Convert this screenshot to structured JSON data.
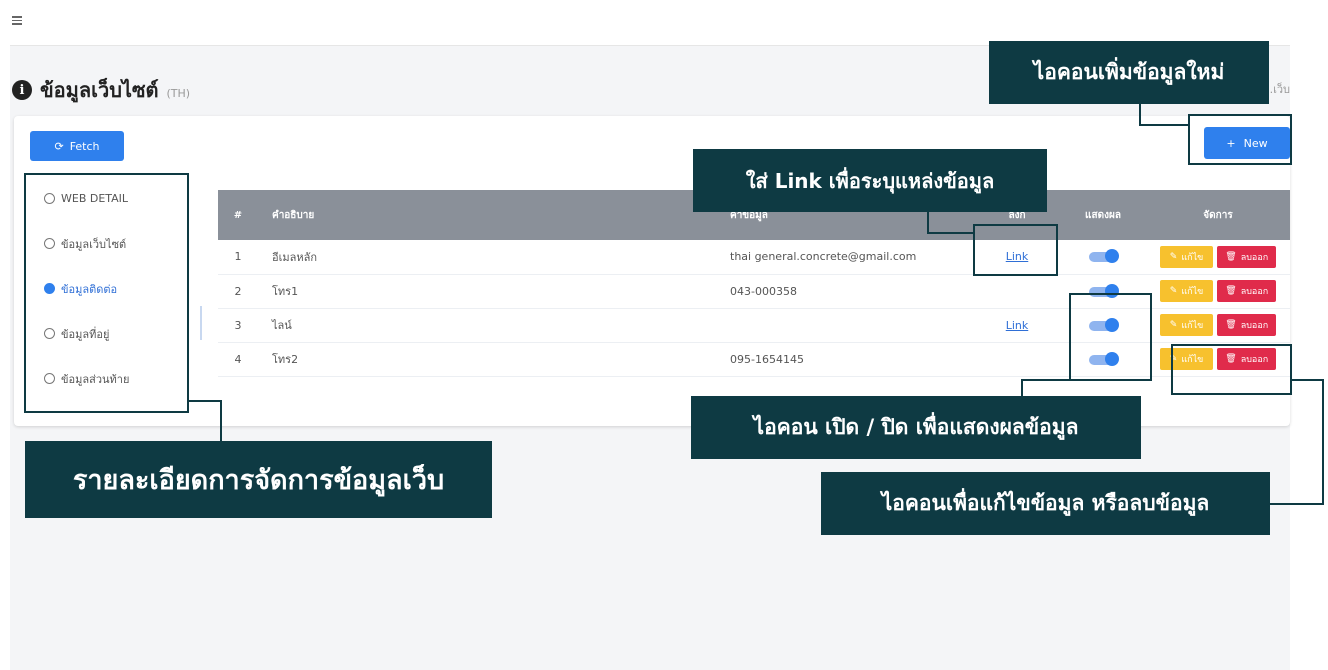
{
  "page": {
    "title": "ข้อมูลเว็บไซต์",
    "title_suffix": "(TH)",
    "breadcrumb": "ล.เว็บ",
    "info_icon": "i"
  },
  "toolbar": {
    "fetch_label": "Fetch",
    "fetch_icon": "⟳",
    "new_label": "New",
    "new_icon": "+"
  },
  "sidebar": {
    "items": [
      {
        "label": "WEB DETAIL",
        "active": false
      },
      {
        "label": "ข้อมูลเว็บไซต์",
        "active": false
      },
      {
        "label": "ข้อมูลติดต่อ",
        "active": true
      },
      {
        "label": "ข้อมูลที่อยู่",
        "active": false
      },
      {
        "label": "ข้อมูลส่วนท้าย",
        "active": false
      }
    ]
  },
  "table": {
    "headers": [
      "#",
      "คำอธิบาย",
      "ค่าข้อมูล",
      "ลิงก์",
      "แสดงผล",
      "จัดการ"
    ],
    "rows": [
      {
        "num": "1",
        "desc": "อีเมลหลัก",
        "value": "thai general.concrete@gmail.com",
        "link": "Link",
        "show": true
      },
      {
        "num": "2",
        "desc": "โทร1",
        "value": "043-000358",
        "link": "",
        "show": true
      },
      {
        "num": "3",
        "desc": "ไลน์",
        "value": "",
        "link": "Link",
        "show": true
      },
      {
        "num": "4",
        "desc": "โทร2",
        "value": "095-1654145",
        "link": "",
        "show": true
      }
    ],
    "edit_label": "แก้ไข",
    "delete_label": "ลบออก",
    "edit_icon": "✎",
    "delete_icon": "🗑"
  },
  "annotations": {
    "add_new": "ไอคอนเพิ่มข้อมูลใหม่",
    "link_source": "ใส่ Link เพื่อระบุแหล่งข้อมูล",
    "toggle_display": "ไอคอน เปิด / ปิด เพื่อแสดงผลข้อมูล",
    "sidebar_detail": "รายละเอียดการจัดการข้อมูลเว็บ",
    "edit_delete": "ไอคอนเพื่อแก้ไขข้อมูล หรือลบข้อมูล"
  },
  "colors": {
    "primary": "#2f80ed",
    "warning": "#f7c12e",
    "danger": "#e02b4b",
    "table_header": "#8a9099",
    "annotation": "#0e3a43"
  }
}
